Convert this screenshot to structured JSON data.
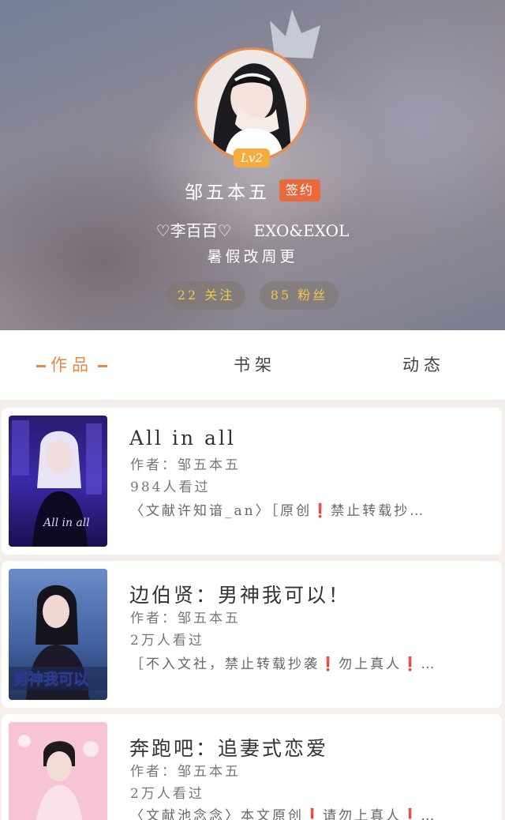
{
  "profile": {
    "level": "Lv2",
    "username": "邹五本五",
    "signed_badge": "签约",
    "bio_line1_a": "♡李百百♡",
    "bio_line1_b": "EXO&EXOL",
    "bio_line2": "暑假改周更",
    "following_count": "22",
    "following_label": "关注",
    "fans_count": "85",
    "fans_label": "粉丝"
  },
  "tabs": {
    "works": "作品",
    "shelf": "书架",
    "feed": "动态"
  },
  "works": [
    {
      "title": "All in all",
      "author": "作者：邹五本五",
      "views": "984人看过",
      "desc_a": "〈文献许知谙_an〉［原创",
      "desc_b": "禁止转载抄…",
      "cover_text": "All in all"
    },
    {
      "title": "边伯贤：男神我可以！",
      "author": "作者：邹五本五",
      "views": "2万人看过",
      "desc_a": "［不入文社，禁止转载抄袭",
      "desc_b": "勿上真人",
      "desc_c": "…",
      "cover_text": "男神我可以"
    },
    {
      "title": "奔跑吧：追妻式恋爱",
      "author": "作者：邹五本五",
      "views": "2万人看过",
      "desc_a": "〈文献池念念〉本文原创",
      "desc_b": "请勿上真人",
      "desc_c": "…"
    }
  ],
  "colors": {
    "accent": "#ef8341",
    "badge_orange": "#ea6a3e",
    "level_yellow": "#f4ad3c",
    "count_yellow": "#f5c842",
    "warning_red": "#d4202a"
  }
}
